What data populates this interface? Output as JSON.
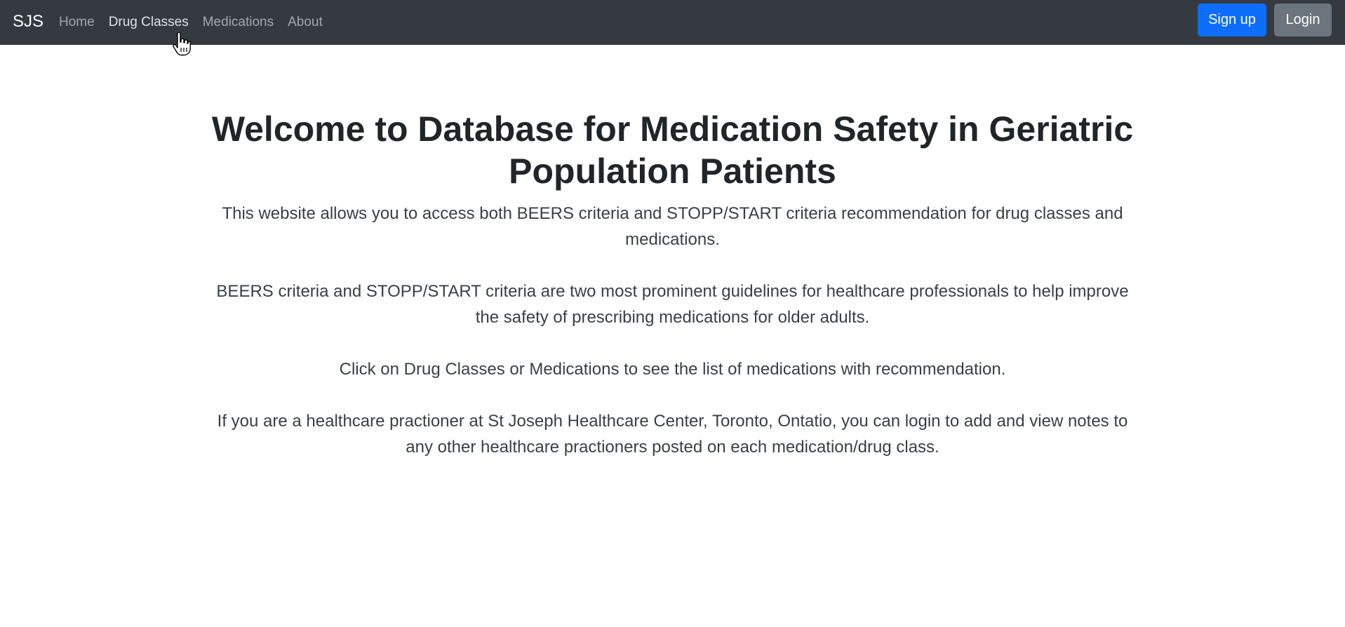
{
  "navbar": {
    "brand": "SJS",
    "links": [
      {
        "label": "Home"
      },
      {
        "label": "Drug Classes"
      },
      {
        "label": "Medications"
      },
      {
        "label": "About"
      }
    ],
    "signup_label": "Sign up",
    "login_label": "Login"
  },
  "main": {
    "title": "Welcome to Database for Medication Safety in Geriatric Population Patients",
    "paragraphs": [
      "This website allows you to access both BEERS criteria and STOPP/START criteria recommendation for drug classes and medications.",
      "BEERS criteria and STOPP/START criteria are two most prominent guidelines for healthcare professionals to help improve the safety of prescribing medications for older adults.",
      "Click on Drug Classes or Medications to see the list of medications with recommendation.",
      "If you are a healthcare practioner at St Joseph Healthcare Center, Toronto, Ontatio, you can login to add and view notes to any other healthcare practioners posted on each medication/drug class."
    ]
  },
  "colors": {
    "navbar_bg": "#343a40",
    "primary": "#0d6efd",
    "secondary": "#6c757d"
  },
  "icons": {
    "cursor": "hand-pointer-cursor-icon"
  }
}
